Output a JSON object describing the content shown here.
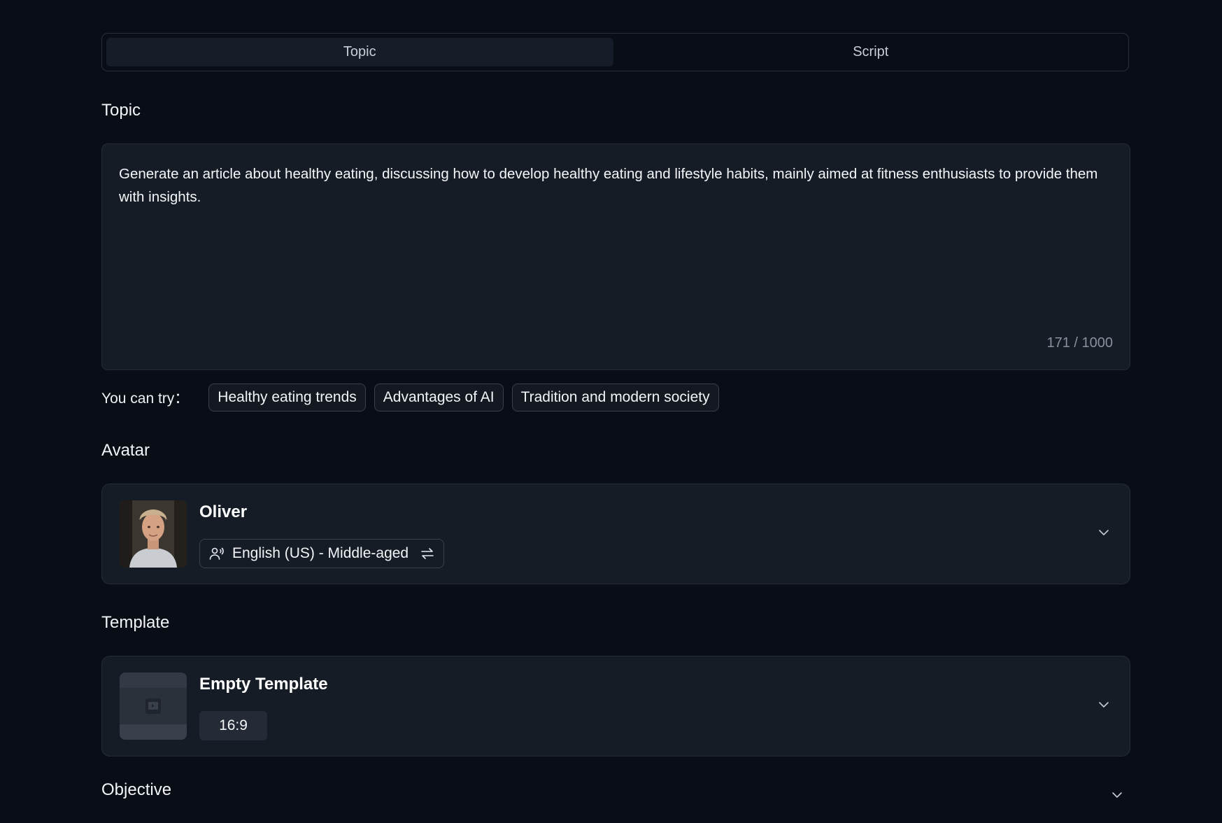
{
  "tabs": [
    {
      "label": "Topic",
      "active": true
    },
    {
      "label": "Script",
      "active": false
    }
  ],
  "topic": {
    "section_label": "Topic",
    "text": "Generate an article about healthy eating, discussing how to develop healthy eating and lifestyle habits, mainly aimed at fitness enthusiasts to provide them with insights.",
    "counter": "171 / 1000"
  },
  "suggestions": {
    "label": "You can try：",
    "chips": [
      "Healthy eating trends",
      "Advantages of AI",
      "Tradition and modern society"
    ]
  },
  "avatar": {
    "section_label": "Avatar",
    "name": "Oliver",
    "voice": "English (US) - Middle-aged",
    "icons": {
      "voice": "person-voice-icon",
      "switch": "switch-arrows-icon",
      "expand": "chevron-down-icon"
    }
  },
  "template": {
    "section_label": "Template",
    "name": "Empty Template",
    "ratio": "16:9",
    "icons": {
      "thumb": "video-placeholder-icon",
      "expand": "chevron-down-icon"
    }
  },
  "objective": {
    "label": "Objective",
    "icon": "chevron-down-icon"
  },
  "colors": {
    "background": "#080d16",
    "card": "#161c26",
    "border": "#262c37",
    "text": "#f2f4f7",
    "muted": "#8b919c"
  }
}
